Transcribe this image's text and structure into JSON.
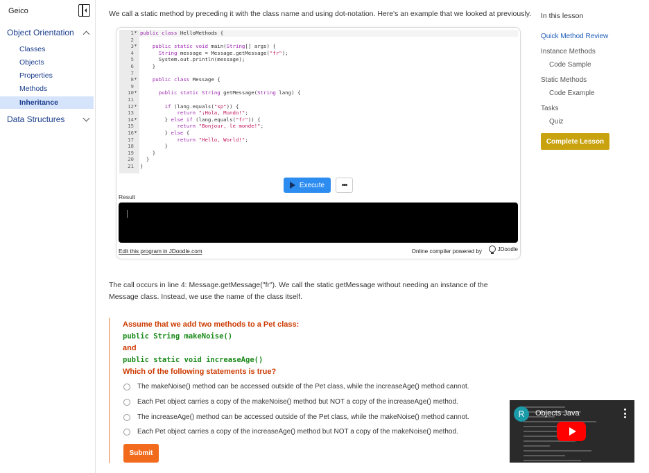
{
  "sidebar": {
    "brand": "Geico",
    "groups": [
      {
        "label": "Object Orientation",
        "expanded": true,
        "items": [
          "Classes",
          "Objects",
          "Properties",
          "Methods",
          "Inheritance"
        ],
        "active_item": "Inheritance"
      },
      {
        "label": "Data Structures",
        "expanded": false
      }
    ]
  },
  "main": {
    "intro": "We call a static method by preceding it with the class name and using dot-notation. Here's an example that we looked at previously.",
    "code_lines": [
      "public class HelloMethods {",
      "",
      "    public static void main(String[] args) {",
      "      String message = Message.getMessage(\"fr\");",
      "      System.out.println(message);",
      "    }",
      "",
      "    public class Message {",
      "",
      "      public static String getMessage(String lang) {",
      "",
      "        if (lang.equals(\"sp\")) {",
      "            return \"¡Hola, Mundo!\";",
      "        } else if (lang.equals(\"fr\")) {",
      "            return \"Bonjour, le monde!\";",
      "        } else {",
      "            return \"Hello, World!\";",
      "        }",
      "    }",
      "  }",
      "}"
    ],
    "fold_lines": [
      1,
      3,
      8,
      10,
      12,
      14,
      16
    ],
    "execute_label": "Execute",
    "more_label": "•••",
    "result_label": "Result",
    "edit_link": "Edit this program in JDoodle.com",
    "powered_by": "Online compiler powered by",
    "jdoodle": "JDoodle",
    "paragraph": "The call occurs in line 4: Message.getMessage(\"fr\"). We call the static getMessage without needing an instance of the Message class. Instead, we use the name of the class itself."
  },
  "quiz": {
    "intro": "Assume that we add two methods to a Pet class:",
    "code1": "public String makeNoise()",
    "and": "and",
    "code2": "public static void increaseAge()",
    "question": "Which of the following statements is true?",
    "options": [
      "The makeNoise() method can be accessed outside of the Pet class, while the increaseAge() method cannot.",
      "Each Pet object carries a copy of the makeNoise() method but NOT a copy of the increaseAge() method.",
      "The increaseAge() method can be accessed outside of the Pet class, while the makeNoise() method cannot.",
      "Each Pet object carries a copy of the increaseAge() method but NOT a copy of the makeNoise() method."
    ],
    "submit": "Submit"
  },
  "toc": {
    "title": "In this lesson",
    "items": [
      "Quick Method Review",
      "Instance Methods",
      "Code Sample",
      "Static Methods",
      "Code Example",
      "Tasks",
      "Quiz"
    ],
    "active_item": "Quick Method Review",
    "complete": "Complete Lesson"
  },
  "video": {
    "channel_initial": "R",
    "title": "Objects Java"
  },
  "colors": {
    "accent_blue": "#2d8cf0",
    "active_nav_bg": "#d5e3fb",
    "quiz_text": "#cc3a00",
    "quiz_code": "#1a8a1a",
    "submit": "#f26b1d",
    "complete": "#c9a30f",
    "youtube_red": "#ff0000"
  },
  "icons": [
    "sidebar-collapse-icon",
    "chevron-up-icon",
    "chevron-down-icon",
    "play-icon",
    "more-icon",
    "jdoodle-logo-icon",
    "radio-icon",
    "kebab-menu-icon",
    "youtube-play-icon"
  ]
}
